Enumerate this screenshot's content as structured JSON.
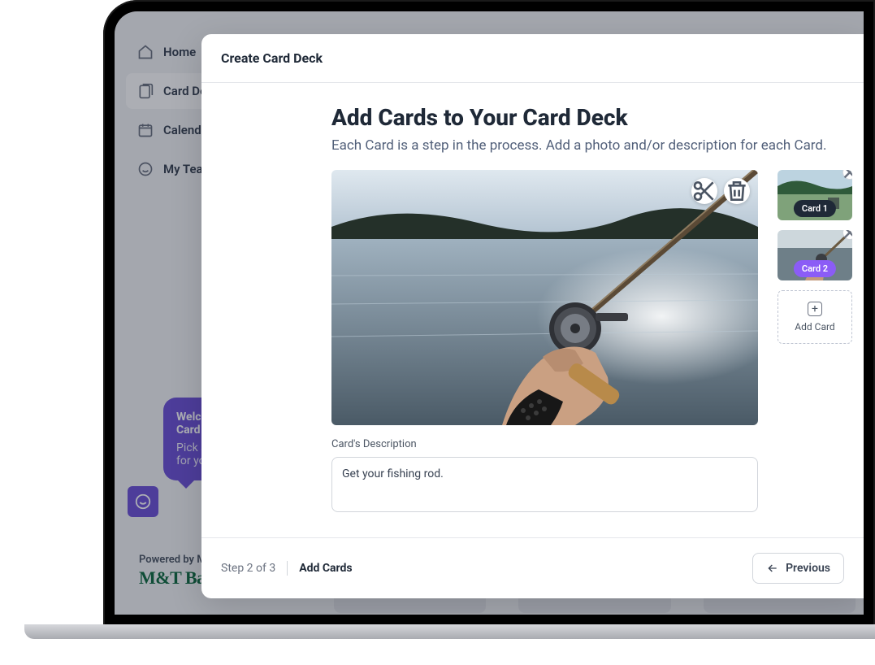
{
  "sidebar": {
    "items": [
      {
        "label": "Home"
      },
      {
        "label": "Card Decks"
      },
      {
        "label": "Calendar"
      },
      {
        "label": "My Team"
      }
    ]
  },
  "chat": {
    "title_line1": "Welcome to",
    "title_line2": "Card Decks!",
    "body_line1": "Pick a template",
    "body_line2": "for you."
  },
  "footer_text": "Powered by M",
  "bank_brand": "M&T Bank",
  "modal": {
    "header": "Create Card Deck",
    "title": "Add Cards to Your Card Deck",
    "subtitle": "Each Card is a step in the process. Add a photo and/or description for each Card.",
    "description_label": "Card's Description",
    "description_value": "Get your fishing rod.",
    "thumbs": [
      {
        "label": "Card 1",
        "variant": "dark"
      },
      {
        "label": "Card 2",
        "variant": "purple"
      }
    ],
    "add_card_label": "Add Card",
    "step_counter": "Step 2 of 3",
    "step_name": "Add Cards",
    "previous_label": "Previous"
  }
}
